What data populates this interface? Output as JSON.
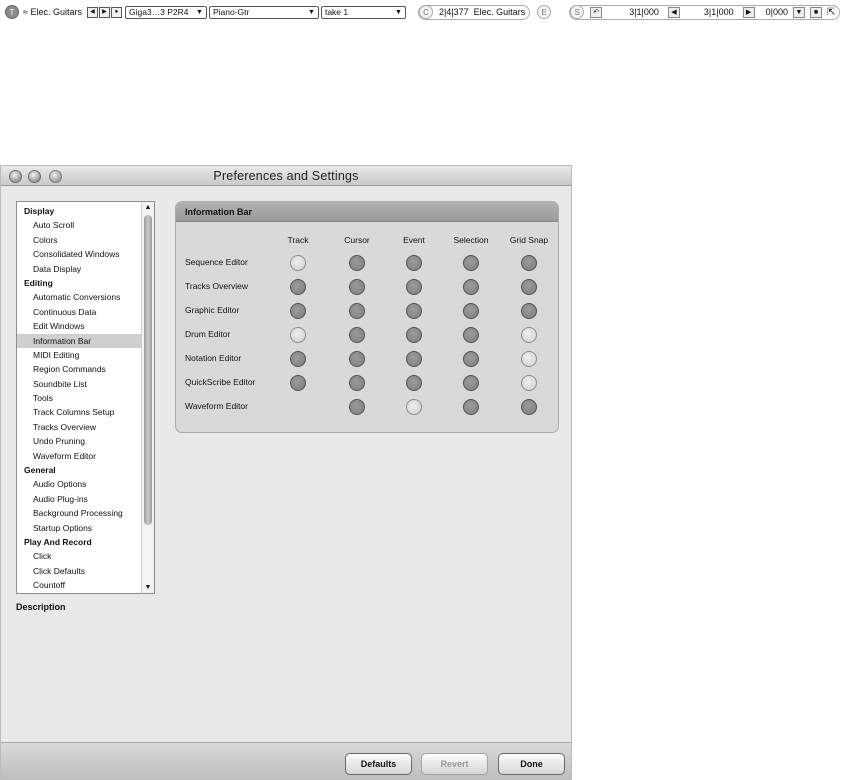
{
  "infobar": {
    "track_circle": "T",
    "track_name": "≈ Elec. Guitars",
    "patch": "Giga3…3 P2R4",
    "instrument": "Piano-Gtr",
    "take": "take 1",
    "cursor_circle": "C",
    "cursor_position": "2|4|377",
    "cursor_track": "Elec. Guitars",
    "edit_circle": "E",
    "selection_circle": "S",
    "selection_start": "3|1|000",
    "selection_end": "3|1|000",
    "selection_length": "0|000"
  },
  "window": {
    "title": "Preferences and Settings"
  },
  "sidebar": {
    "items": [
      {
        "label": "Display",
        "type": "header"
      },
      {
        "label": "Auto Scroll",
        "type": "item"
      },
      {
        "label": "Colors",
        "type": "item"
      },
      {
        "label": "Consolidated Windows",
        "type": "item"
      },
      {
        "label": "Data Display",
        "type": "item"
      },
      {
        "label": "Editing",
        "type": "header"
      },
      {
        "label": "Automatic Conversions",
        "type": "item"
      },
      {
        "label": "Continuous Data",
        "type": "item"
      },
      {
        "label": "Edit Windows",
        "type": "item"
      },
      {
        "label": "Information Bar",
        "type": "item",
        "selected": true
      },
      {
        "label": "MIDI Editing",
        "type": "item"
      },
      {
        "label": "Region Commands",
        "type": "item"
      },
      {
        "label": "Soundbite List",
        "type": "item"
      },
      {
        "label": "Tools",
        "type": "item"
      },
      {
        "label": "Track Columns Setup",
        "type": "item"
      },
      {
        "label": "Tracks Overview",
        "type": "item"
      },
      {
        "label": "Undo Pruning",
        "type": "item"
      },
      {
        "label": "Waveform Editor",
        "type": "item"
      },
      {
        "label": "General",
        "type": "header"
      },
      {
        "label": "Audio Options",
        "type": "item"
      },
      {
        "label": "Audio Plug-ins",
        "type": "item"
      },
      {
        "label": "Background Processing",
        "type": "item"
      },
      {
        "label": "Startup Options",
        "type": "item"
      },
      {
        "label": "Play And Record",
        "type": "header"
      },
      {
        "label": "Click",
        "type": "item"
      },
      {
        "label": "Click Defaults",
        "type": "item"
      },
      {
        "label": "Countoff",
        "type": "item"
      }
    ]
  },
  "description": {
    "label": "Description"
  },
  "info_panel": {
    "title": "Information Bar",
    "columns": [
      "Track",
      "Cursor",
      "Event",
      "Selection",
      "Grid Snap"
    ],
    "rows": [
      {
        "label": "Sequence Editor",
        "states": [
          false,
          true,
          true,
          true,
          true
        ]
      },
      {
        "label": "Tracks Overview",
        "states": [
          true,
          true,
          true,
          true,
          true
        ]
      },
      {
        "label": "Graphic Editor",
        "states": [
          true,
          true,
          true,
          true,
          true
        ]
      },
      {
        "label": "Drum Editor",
        "states": [
          false,
          true,
          true,
          true,
          false
        ]
      },
      {
        "label": "Notation Editor",
        "states": [
          true,
          true,
          true,
          true,
          false
        ]
      },
      {
        "label": "QuickScribe Editor",
        "states": [
          true,
          true,
          true,
          true,
          false
        ]
      },
      {
        "label": "Waveform Editor",
        "states": [
          null,
          true,
          false,
          true,
          true
        ]
      }
    ]
  },
  "buttons": {
    "defaults": "Defaults",
    "revert": "Revert",
    "done": "Done"
  }
}
